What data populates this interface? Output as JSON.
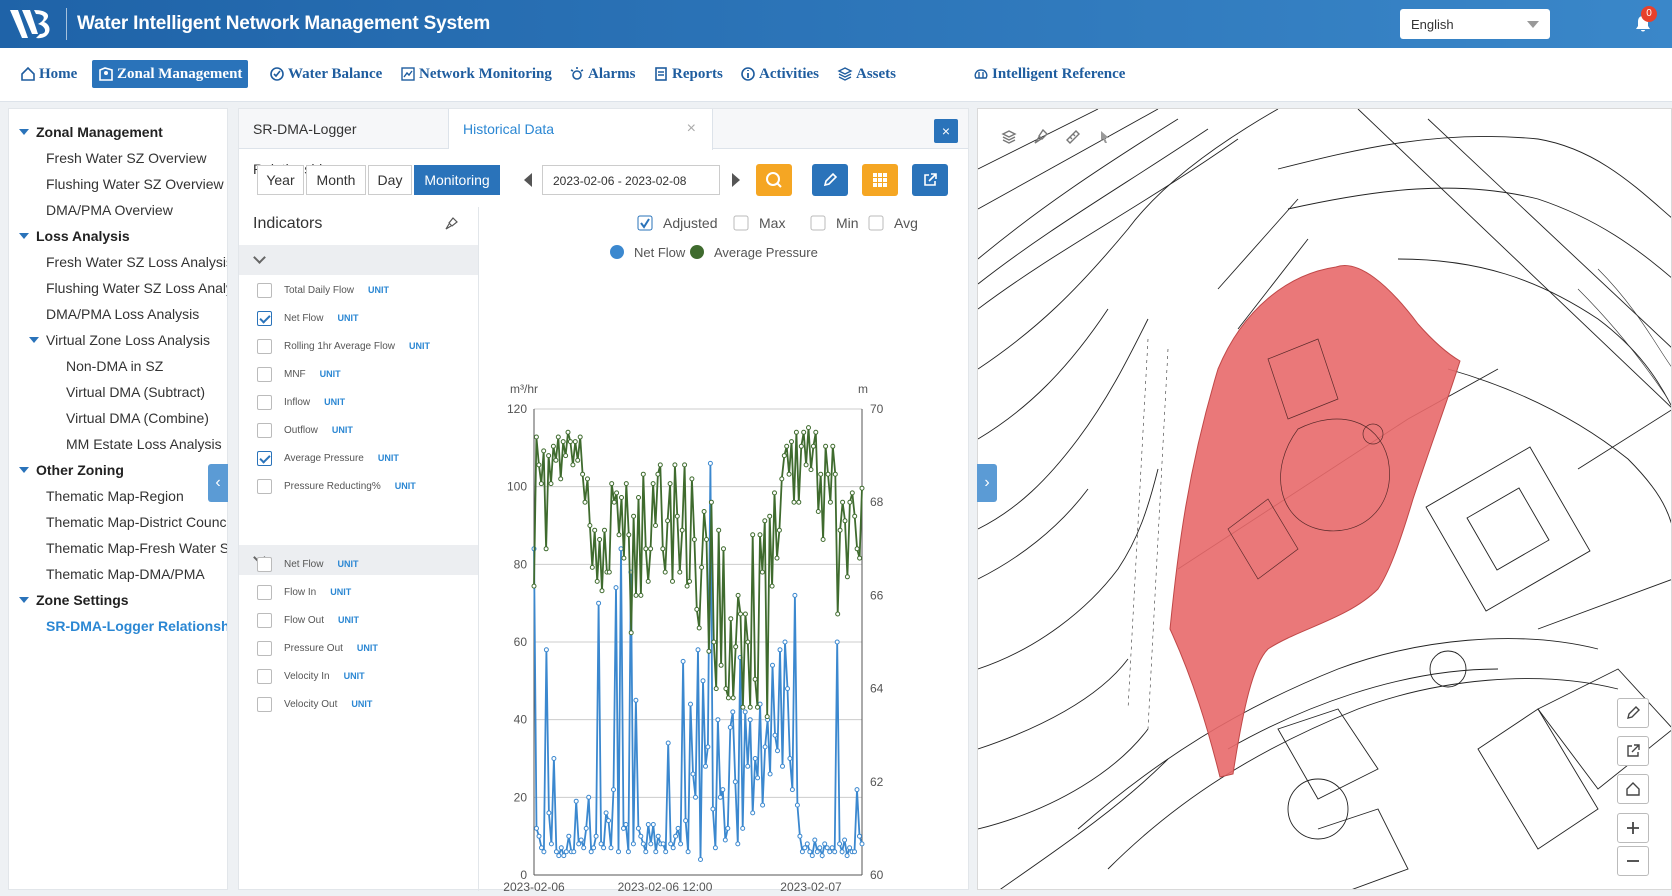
{
  "app": {
    "title": "Water Intelligent Network Management System",
    "language": "English",
    "notification_count": "0"
  },
  "nav": {
    "items": [
      {
        "label": "Home",
        "icon": "home-icon"
      },
      {
        "label": "Zonal Management",
        "icon": "map-icon"
      },
      {
        "label": "Water Balance",
        "icon": "check-circle-icon"
      },
      {
        "label": "Network Monitoring",
        "icon": "chart-line-icon"
      },
      {
        "label": "Alarms",
        "icon": "alarm-icon"
      },
      {
        "label": "Reports",
        "icon": "document-icon"
      },
      {
        "label": "Activities",
        "icon": "info-icon"
      },
      {
        "label": "Assets",
        "icon": "layers-icon"
      },
      {
        "label": "Intelligent Reference",
        "icon": "brain-icon"
      }
    ]
  },
  "tree": {
    "items": [
      {
        "label": "Zonal Management"
      },
      {
        "label": "Fresh Water SZ Overview"
      },
      {
        "label": "Flushing Water SZ Overview"
      },
      {
        "label": "DMA/PMA Overview"
      },
      {
        "label": "Loss Analysis"
      },
      {
        "label": "Fresh Water SZ Loss Analysis"
      },
      {
        "label": "Flushing Water SZ Loss Analy"
      },
      {
        "label": "DMA/PMA Loss Analysis"
      },
      {
        "label": "Virtual Zone Loss Analysis"
      },
      {
        "label": "Non-DMA in SZ"
      },
      {
        "label": "Virtual DMA (Subtract)"
      },
      {
        "label": "Virtual DMA (Combine)"
      },
      {
        "label": "MM Estate Loss Analysis"
      },
      {
        "label": "Other Zoning"
      },
      {
        "label": "Thematic Map-Region"
      },
      {
        "label": "Thematic Map-District Counc"
      },
      {
        "label": "Thematic Map-Fresh Water S"
      },
      {
        "label": "Thematic Map-DMA/PMA"
      },
      {
        "label": "Zone Settings"
      },
      {
        "label": "SR-DMA-Logger Relationship"
      }
    ]
  },
  "tabs": {
    "tab1": "SR-DMA-Logger Relationship",
    "tab2": "Historical Data",
    "close": "×"
  },
  "toolbar": {
    "year": "Year",
    "month": "Month",
    "day": "Day",
    "monitoring": "Monitoring",
    "date_range": "2023-02-06 - 2023-02-08"
  },
  "indicators": {
    "title": "Indicators",
    "unit_label": "UNIT",
    "group1": [
      {
        "label": "Total Daily Flow",
        "checked": false
      },
      {
        "label": "Net Flow",
        "checked": true
      },
      {
        "label": "Rolling 1hr Average Flow",
        "checked": false
      },
      {
        "label": "MNF",
        "checked": false
      },
      {
        "label": "Inflow",
        "checked": false
      },
      {
        "label": "Outflow",
        "checked": false
      },
      {
        "label": "Average Pressure",
        "checked": true
      },
      {
        "label": "Pressure Reducting%",
        "checked": false
      }
    ],
    "group2": [
      {
        "label": "Net Flow",
        "checked": false
      },
      {
        "label": "Flow In",
        "checked": false
      },
      {
        "label": "Flow Out",
        "checked": false
      },
      {
        "label": "Pressure Out",
        "checked": false
      },
      {
        "label": "Velocity In",
        "checked": false
      },
      {
        "label": "Velocity Out",
        "checked": false
      }
    ]
  },
  "options": [
    {
      "label": "Adjusted",
      "checked": true
    },
    {
      "label": "Max",
      "checked": false
    },
    {
      "label": "Min",
      "checked": false
    },
    {
      "label": "Avg",
      "checked": false
    }
  ],
  "colors": {
    "primary": "#2a73ba",
    "flow": "#3b88cf",
    "pressure": "#3f6b2e",
    "zone": "#e8696a",
    "search": "#f5a623"
  },
  "chart_data": {
    "type": "line",
    "series": [
      {
        "name": "Net Flow",
        "axis": "left",
        "color": "#3b88cf",
        "values": [
          84,
          12,
          10,
          7,
          6,
          58,
          16,
          8,
          30,
          6,
          5,
          7,
          5,
          6,
          10,
          6,
          6,
          19,
          8,
          9,
          7,
          12,
          20,
          6,
          7,
          10,
          70,
          8,
          7,
          16,
          14,
          7,
          22,
          74,
          6,
          84,
          12,
          13,
          6,
          78,
          8,
          45,
          12,
          10,
          8,
          6,
          13,
          8,
          13,
          6,
          10,
          8,
          8,
          6,
          34,
          8,
          7,
          10,
          12,
          8,
          55,
          14,
          6,
          44,
          26,
          20,
          58,
          4,
          50,
          28,
          33,
          106,
          17,
          7,
          40,
          20,
          22,
          9,
          12,
          38,
          42,
          24,
          8,
          56,
          12,
          42,
          28,
          40,
          16,
          30,
          25,
          44,
          18,
          33,
          40,
          26,
          54,
          36,
          32,
          58,
          28,
          60,
          48,
          30,
          22,
          72,
          18,
          10,
          6,
          7,
          8,
          6,
          5,
          9,
          6,
          7,
          5,
          8,
          7,
          6,
          7,
          6,
          60,
          8,
          6,
          9,
          5,
          7,
          6,
          6,
          22,
          10,
          8
        ]
      },
      {
        "name": "Average Pressure",
        "axis": "right",
        "color": "#3f6b2e",
        "values": [
          66.2,
          69.4,
          68.8,
          68.4,
          69.1,
          67.0,
          69.0,
          68.4,
          69.2,
          68.9,
          69.4,
          68.5,
          69.3,
          69.0,
          69.5,
          69.3,
          68.8,
          69.3,
          68.9,
          69.4,
          68.6,
          68.0,
          68.5,
          67.5,
          66.6,
          67.4,
          66.3,
          67.2,
          66.1,
          67.4,
          66.5,
          66.5,
          68.4,
          68.0,
          68.2,
          67.3,
          68.1,
          66.8,
          68.4,
          67.3,
          65.2,
          67.7,
          66.0,
          68.1,
          66.0,
          68.6,
          67.0,
          66.3,
          67.0,
          68.4,
          67.5,
          68.6,
          68.8,
          67.0,
          66.5,
          67.6,
          68.4,
          66.3,
          68.8,
          67.7,
          66.5,
          67.4,
          68.8,
          66.2,
          66.3,
          68.5,
          67.2,
          65.7,
          65.3,
          66.6,
          67.8,
          67.2,
          64.8,
          68.0,
          65.0,
          64.0,
          67.4,
          64.5,
          67.0,
          64.0,
          63.8,
          65.5,
          63.8,
          64.9,
          66.0,
          65.6,
          63.6,
          65.6,
          65.0,
          63.6,
          67.3,
          64.2,
          63.6,
          67.3,
          66.5,
          67.6,
          63.4,
          67.7,
          66.2,
          68.2,
          66.8,
          67.4,
          68.5,
          69.0,
          69.2,
          68.6,
          69.3,
          68.0,
          69.5,
          68.0,
          69.2,
          69.5,
          68.8,
          69.6,
          68.7,
          69.2,
          69.5,
          67.8,
          68.6,
          67.2,
          69.2,
          68.6,
          68.0,
          69.2,
          68.6,
          65.6,
          67.4,
          68.0,
          67.6,
          66.4,
          68.0,
          68.2,
          67.7,
          67.0,
          66.8,
          68.3
        ]
      }
    ],
    "y_left": {
      "label": "m³/hr",
      "min": 0,
      "max": 120,
      "ticks": [
        0,
        20,
        40,
        60,
        80,
        100,
        120
      ]
    },
    "y_right": {
      "label": "m",
      "min": 60,
      "max": 70,
      "ticks": [
        60,
        62,
        64,
        66,
        68,
        70
      ]
    },
    "x_ticks": [
      "2023-02-06",
      "2023-02-06 12:00",
      "2023-02-07"
    ],
    "legend": [
      "Net Flow",
      "Average Pressure"
    ],
    "grid": true
  }
}
